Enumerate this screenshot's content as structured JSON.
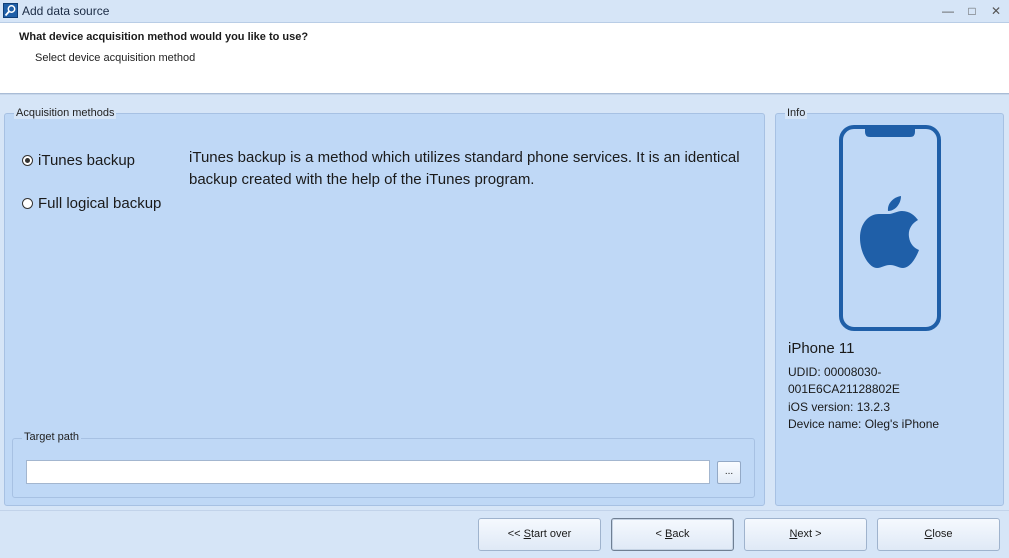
{
  "window": {
    "title": "Add data source",
    "controls": {
      "minimize": "—",
      "maximize": "□",
      "close": "✕"
    }
  },
  "header": {
    "title": "What device acquisition method would you like to use?",
    "subtitle": "Select device acquisition method"
  },
  "methods": {
    "legend": "Acquisition methods",
    "options": [
      {
        "label": "iTunes backup",
        "checked": true
      },
      {
        "label": "Full logical backup",
        "checked": false
      }
    ],
    "description": "iTunes backup is a method which utilizes standard phone services. It is an identical backup created with the help of the iTunes program."
  },
  "target": {
    "legend": "Target path",
    "value": "",
    "browse_label": "..."
  },
  "info": {
    "legend": "Info",
    "icon": "iphone-apple-icon",
    "device_model": "iPhone 11",
    "udid_line1": "UDID: 00008030-",
    "udid_line2": "001E6CA21128802E",
    "ios_version": "iOS version: 13.2.3",
    "device_name": "Device name: Oleg's iPhone"
  },
  "footer": {
    "start_over_prefix": "<< ",
    "start_over_key": "S",
    "start_over_rest": "tart over",
    "back_prefix": "< ",
    "back_key": "B",
    "back_rest": "ack",
    "next_key": "N",
    "next_rest": "ext >",
    "close_key": "C",
    "close_rest": "lose"
  },
  "colors": {
    "accent": "#1f5fa8",
    "panel": "#bfd8f6",
    "background": "#d6e5f7"
  }
}
